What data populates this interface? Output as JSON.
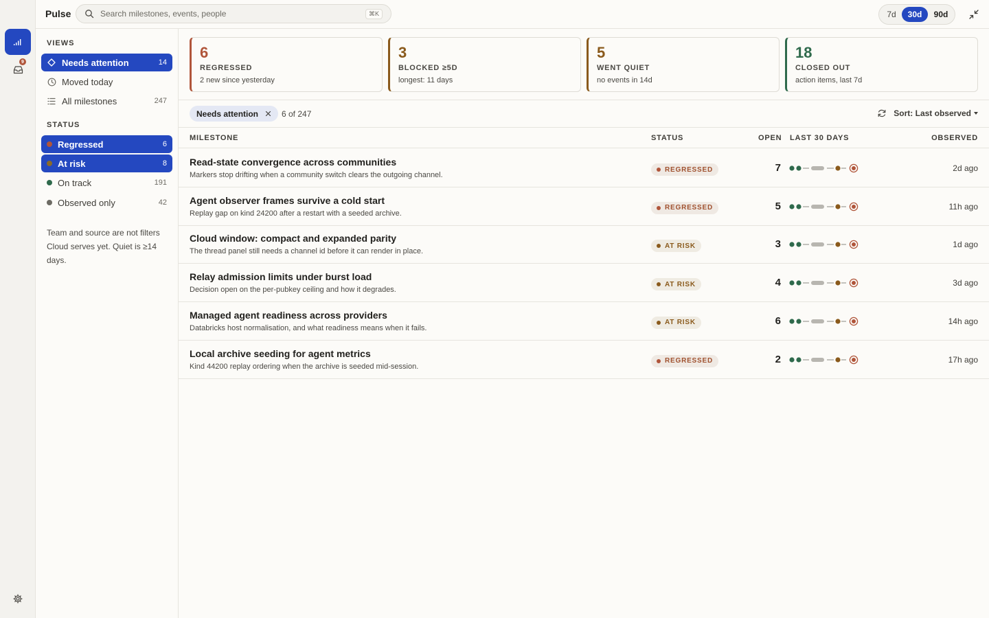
{
  "app": {
    "title": "Pulse"
  },
  "rail": {
    "inbox_badge": "9"
  },
  "search": {
    "placeholder": "Search milestones, events, people",
    "shortcut": "⌘K"
  },
  "range": {
    "options": [
      "7d",
      "30d",
      "90d"
    ],
    "selected": "30d"
  },
  "sidebar": {
    "views_heading": "VIEWS",
    "views": [
      {
        "label": "Needs attention",
        "count": "14",
        "selected": true
      },
      {
        "label": "Moved today",
        "count": ""
      },
      {
        "label": "All milestones",
        "count": "247"
      }
    ],
    "status_heading": "STATUS",
    "statuses": [
      {
        "label": "Regressed",
        "count": "6",
        "color": "#b0553a",
        "selected": true
      },
      {
        "label": "At risk",
        "count": "8",
        "color": "#8a6a2a",
        "selected": true
      },
      {
        "label": "On track",
        "count": "191",
        "color": "#2f6a4c"
      },
      {
        "label": "Observed only",
        "count": "42",
        "color": "#6d6b64"
      }
    ],
    "note": "Team and source are not filters Cloud serves yet. Quiet is ≥14 days."
  },
  "cards": [
    {
      "num": "6",
      "label": "REGRESSED",
      "sub": "2 new since yesterday",
      "color": "#b0553a"
    },
    {
      "num": "3",
      "label": "BLOCKED ≥5D",
      "sub": "longest: 11 days",
      "color": "#8a5a1c"
    },
    {
      "num": "5",
      "label": "WENT QUIET",
      "sub": "no events in 14d",
      "color": "#8a5a1c"
    },
    {
      "num": "18",
      "label": "CLOSED OUT",
      "sub": "action items, last 7d",
      "color": "#2f6a4c"
    }
  ],
  "filter": {
    "chip": "Needs attention",
    "count": "6 of 247",
    "sort": "Sort: Last observed"
  },
  "table": {
    "headers": {
      "milestone": "MILESTONE",
      "status": "STATUS",
      "open": "OPEN",
      "last30": "LAST 30 DAYS",
      "observed": "OBSERVED"
    },
    "rows": [
      {
        "title": "Read-state convergence across communities",
        "desc": "Markers stop drifting when a community switch clears the outgoing channel.",
        "status": "REGRESSED",
        "kind": "reg",
        "open": "7",
        "observed": "2d ago"
      },
      {
        "title": "Agent observer frames survive a cold start",
        "desc": "Replay gap on kind 24200 after a restart with a seeded archive.",
        "status": "REGRESSED",
        "kind": "reg",
        "open": "5",
        "observed": "11h ago"
      },
      {
        "title": "Cloud window: compact and expanded parity",
        "desc": "The thread panel still needs a channel id before it can render in place.",
        "status": "AT RISK",
        "kind": "risk",
        "open": "3",
        "observed": "1d ago"
      },
      {
        "title": "Relay admission limits under burst load",
        "desc": "Decision open on the per-pubkey ceiling and how it degrades.",
        "status": "AT RISK",
        "kind": "risk",
        "open": "4",
        "observed": "3d ago"
      },
      {
        "title": "Managed agent readiness across providers",
        "desc": "Databricks host normalisation, and what readiness means when it fails.",
        "status": "AT RISK",
        "kind": "risk",
        "open": "6",
        "observed": "14h ago"
      },
      {
        "title": "Local archive seeding for agent metrics",
        "desc": "Kind 44200 replay ordering when the archive is seeded mid-session.",
        "status": "REGRESSED",
        "kind": "reg",
        "open": "2",
        "observed": "17h ago"
      }
    ]
  }
}
